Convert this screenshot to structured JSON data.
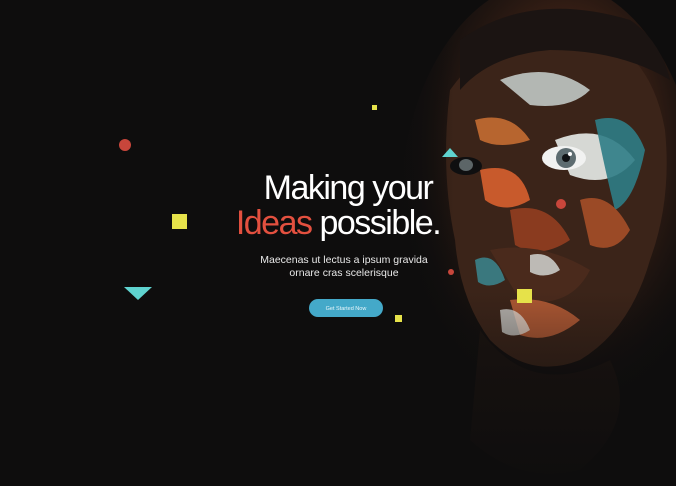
{
  "hero": {
    "headline_line1": "Making your",
    "headline_accent": "Ideas",
    "headline_rest": " possible.",
    "subtitle_line1": "Maecenas ut lectus a ipsum gravida",
    "subtitle_line2": "ornare cras scelerisque",
    "cta_label": "Get Started Now"
  },
  "colors": {
    "background": "#0e0d0d",
    "accent_red": "#e3503f",
    "accent_teal": "#5fd3cf",
    "accent_yellow": "#e6e24a",
    "button": "#44a9c9"
  },
  "decorations": [
    "red-circle-icon",
    "yellow-square-icon",
    "teal-triangle-icon"
  ]
}
